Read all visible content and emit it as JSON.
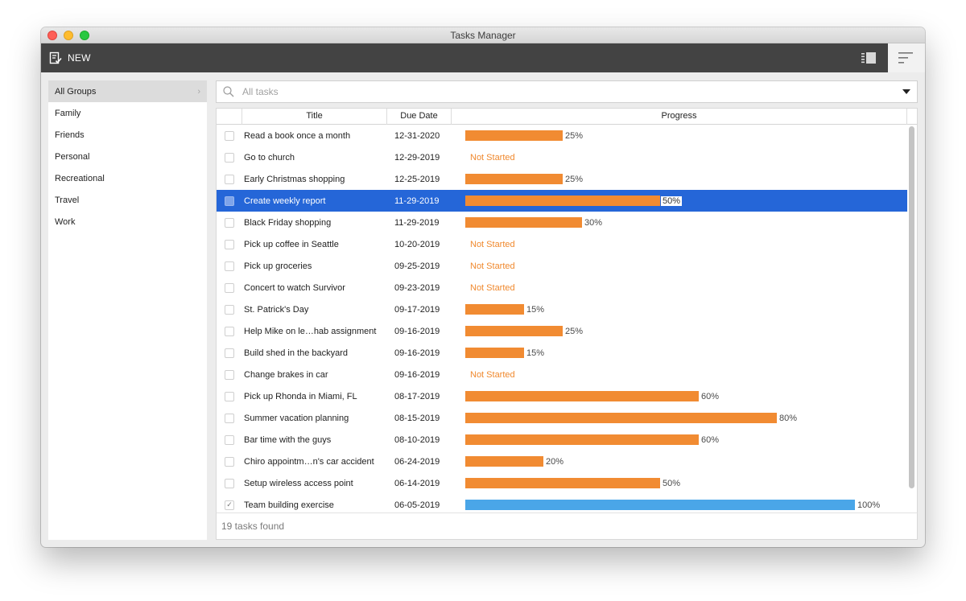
{
  "window": {
    "title": "Tasks Manager"
  },
  "toolbar": {
    "new_label": "NEW",
    "new_icon": "new-task-icon",
    "list_view_icon": "list-view-icon",
    "gantt_view_icon": "gantt-view-icon"
  },
  "sidebar": {
    "items": [
      {
        "label": "All Groups",
        "active": true
      },
      {
        "label": "Family"
      },
      {
        "label": "Friends"
      },
      {
        "label": "Personal"
      },
      {
        "label": "Recreational"
      },
      {
        "label": "Travel"
      },
      {
        "label": "Work"
      }
    ]
  },
  "search": {
    "placeholder": "All tasks"
  },
  "table": {
    "headers": {
      "title": "Title",
      "due_date": "Due Date",
      "progress": "Progress"
    },
    "rows": [
      {
        "title": "Read a book once a month",
        "date": "12-31-2020",
        "progress": 25,
        "label": "25%"
      },
      {
        "title": "Go to church",
        "date": "12-29-2019",
        "progress": 0,
        "label": "Not Started"
      },
      {
        "title": "Early Christmas shopping",
        "date": "12-25-2019",
        "progress": 25,
        "label": "25%"
      },
      {
        "title": "Create weekly report",
        "date": "11-29-2019",
        "progress": 50,
        "label": "50%",
        "selected": true
      },
      {
        "title": "Black Friday shopping",
        "date": "11-29-2019",
        "progress": 30,
        "label": "30%"
      },
      {
        "title": "Pick up coffee in Seattle",
        "date": "10-20-2019",
        "progress": 0,
        "label": "Not Started"
      },
      {
        "title": "Pick up groceries",
        "date": "09-25-2019",
        "progress": 0,
        "label": "Not Started"
      },
      {
        "title": "Concert to watch Survivor",
        "date": "09-23-2019",
        "progress": 0,
        "label": "Not Started"
      },
      {
        "title": "St. Patrick's Day",
        "date": "09-17-2019",
        "progress": 15,
        "label": "15%"
      },
      {
        "title": "Help Mike on le…hab assignment",
        "date": "09-16-2019",
        "progress": 25,
        "label": "25%"
      },
      {
        "title": "Build shed in the backyard",
        "date": "09-16-2019",
        "progress": 15,
        "label": "15%"
      },
      {
        "title": "Change brakes in car",
        "date": "09-16-2019",
        "progress": 0,
        "label": "Not Started"
      },
      {
        "title": "Pick up Rhonda in Miami, FL",
        "date": "08-17-2019",
        "progress": 60,
        "label": "60%"
      },
      {
        "title": "Summer vacation planning",
        "date": "08-15-2019",
        "progress": 80,
        "label": "80%"
      },
      {
        "title": "Bar time with the guys",
        "date": "08-10-2019",
        "progress": 60,
        "label": "60%"
      },
      {
        "title": "Chiro appointm…n's car accident",
        "date": "06-24-2019",
        "progress": 20,
        "label": "20%"
      },
      {
        "title": "Setup wireless access point",
        "date": "06-14-2019",
        "progress": 50,
        "label": "50%"
      },
      {
        "title": "Team building exercise",
        "date": "06-05-2019",
        "progress": 100,
        "label": "100%",
        "checked": true
      }
    ]
  },
  "footer": {
    "status": "19 tasks found"
  },
  "colors": {
    "accent": "#2566d8",
    "progress": "#f18b32",
    "complete": "#4aa6e8",
    "toolbar": "#434343"
  }
}
